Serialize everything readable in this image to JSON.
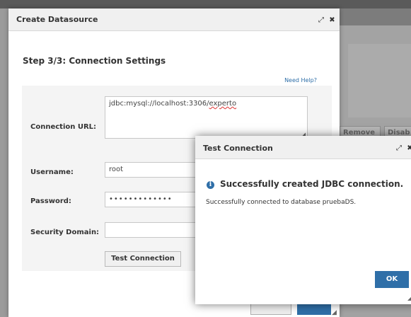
{
  "background": {
    "buttons": {
      "remove": "Remove",
      "disable": "Disab"
    }
  },
  "create_dialog": {
    "title": "Create Datasource",
    "step_title": "Step 3/3: Connection Settings",
    "need_help": "Need Help?",
    "fields": {
      "connection_url": {
        "label": "Connection URL:",
        "value_prefix": "jdbc:mysql://localhost:3306/",
        "value_misspelled": "experto"
      },
      "username": {
        "label": "Username:",
        "value": "root"
      },
      "password": {
        "label": "Password:",
        "value": "•••••••••••••"
      },
      "security_domain": {
        "label": "Security Domain:",
        "value": ""
      }
    },
    "test_button": "Test Connection"
  },
  "test_dialog": {
    "title": "Test Connection",
    "success_title": "Successfully created JDBC connection.",
    "success_message": "Successfully connected to database pruebaDS.",
    "ok_button": "OK"
  },
  "icons": {
    "maximize": "⤢",
    "close": "✖",
    "info": "i",
    "resize": "◢"
  },
  "colors": {
    "accent": "#2f6fa8",
    "overlay": "#9b9b9b"
  }
}
